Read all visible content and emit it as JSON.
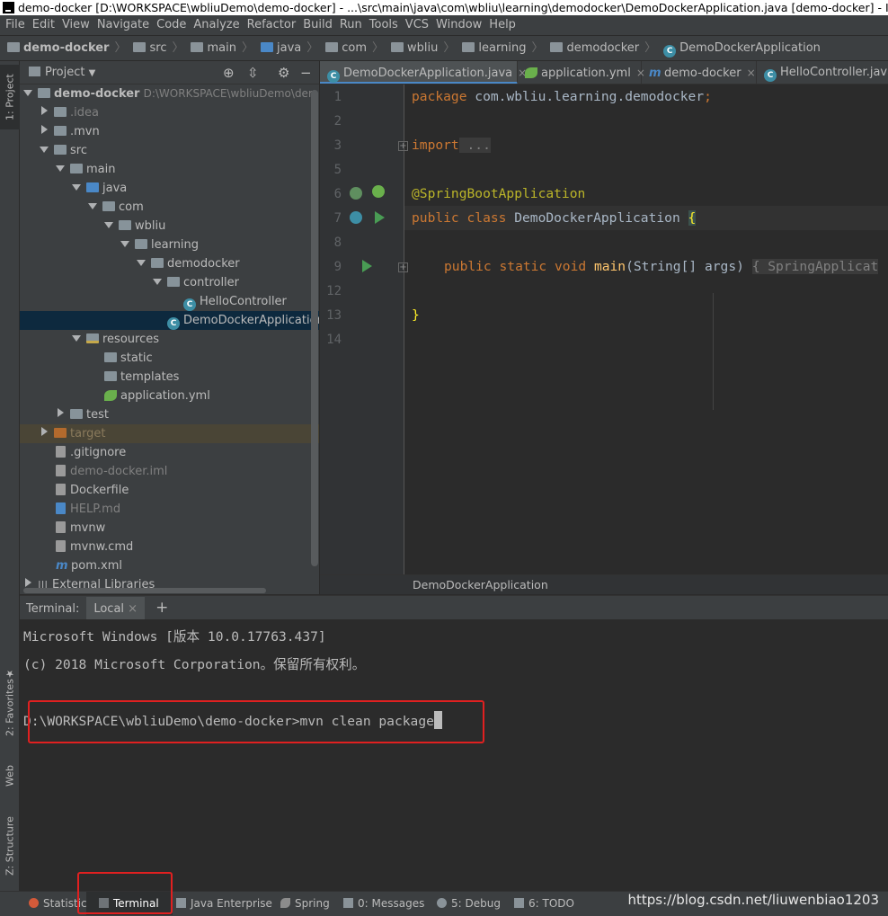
{
  "window": {
    "title": "demo-docker [D:\\WORKSPACE\\wbliuDemo\\demo-docker] - ...\\src\\main\\java\\com\\wbliu\\learning\\demodocker\\DemoDockerApplication.java [demo-docker] - IntelliJ IDEA"
  },
  "menu": [
    "File",
    "Edit",
    "View",
    "Navigate",
    "Code",
    "Analyze",
    "Refactor",
    "Build",
    "Run",
    "Tools",
    "VCS",
    "Window",
    "Help"
  ],
  "breadcrumb": [
    "demo-docker",
    "src",
    "main",
    "java",
    "com",
    "wbliu",
    "learning",
    "demodocker",
    "DemoDockerApplication"
  ],
  "left_strip": {
    "project": "1: Project",
    "favorites": "2: Favorites",
    "web": "Web",
    "structure": "Z: Structure"
  },
  "project": {
    "header": "Project",
    "root": {
      "name": "demo-docker",
      "path": "D:\\WORKSPACE\\wbliuDemo\\demo-docker"
    },
    "tree": [
      {
        "label": ".idea"
      },
      {
        "label": ".mvn"
      },
      {
        "label": "src"
      },
      {
        "label": "main"
      },
      {
        "label": "java"
      },
      {
        "label": "com"
      },
      {
        "label": "wbliu"
      },
      {
        "label": "learning"
      },
      {
        "label": "demodocker"
      },
      {
        "label": "controller"
      },
      {
        "label": "HelloController"
      },
      {
        "label": "DemoDockerApplication"
      },
      {
        "label": "resources"
      },
      {
        "label": "static"
      },
      {
        "label": "templates"
      },
      {
        "label": "application.yml"
      },
      {
        "label": "test"
      },
      {
        "label": "target"
      },
      {
        "label": ".gitignore"
      },
      {
        "label": "demo-docker.iml"
      },
      {
        "label": "Dockerfile"
      },
      {
        "label": "HELP.md"
      },
      {
        "label": "mvnw"
      },
      {
        "label": "mvnw.cmd"
      },
      {
        "label": "pom.xml"
      },
      {
        "label": "External Libraries"
      }
    ]
  },
  "tabs": [
    {
      "label": "DemoDockerApplication.java",
      "active": true
    },
    {
      "label": "application.yml"
    },
    {
      "label": "demo-docker"
    },
    {
      "label": "HelloController.java"
    }
  ],
  "editor": {
    "line_numbers": [
      "1",
      "2",
      "3",
      "5",
      "6",
      "7",
      "8",
      "9",
      "12",
      "13",
      "14"
    ],
    "package_kw": "package",
    "package_name": " com.wbliu.learning.demodocker",
    "semicolon": ";",
    "import_kw": "import",
    "import_fold": " ...",
    "annotation": "@SpringBootApplication",
    "class_mod": "public class",
    "class_name": " DemoDockerApplication ",
    "brace_open": "{",
    "main_mod": "public static void",
    "main_name": " main",
    "main_args": "(String[] args) ",
    "main_body": "{ SpringApplicat",
    "brace_close": "}"
  },
  "editor_crumb": "DemoDockerApplication",
  "terminal": {
    "label": "Terminal:",
    "tab": "Local",
    "lines": [
      "Microsoft Windows [版本 10.0.17763.437]",
      "(c) 2018 Microsoft Corporation。保留所有权利。"
    ],
    "prompt": "D:\\WORKSPACE\\wbliuDemo\\demo-docker>",
    "command": "mvn clean package"
  },
  "status": {
    "items": [
      "Statistic",
      "Terminal",
      "Java Enterprise",
      "Spring",
      "0: Messages",
      "5: Debug",
      "6: TODO"
    ],
    "watermark": "https://blog.csdn.net/liuwenbiao1203"
  },
  "colors": {
    "accent": "#4a88c7",
    "highlight": "#e02020",
    "keyword": "#cc7832",
    "annotation": "#bbb529"
  }
}
